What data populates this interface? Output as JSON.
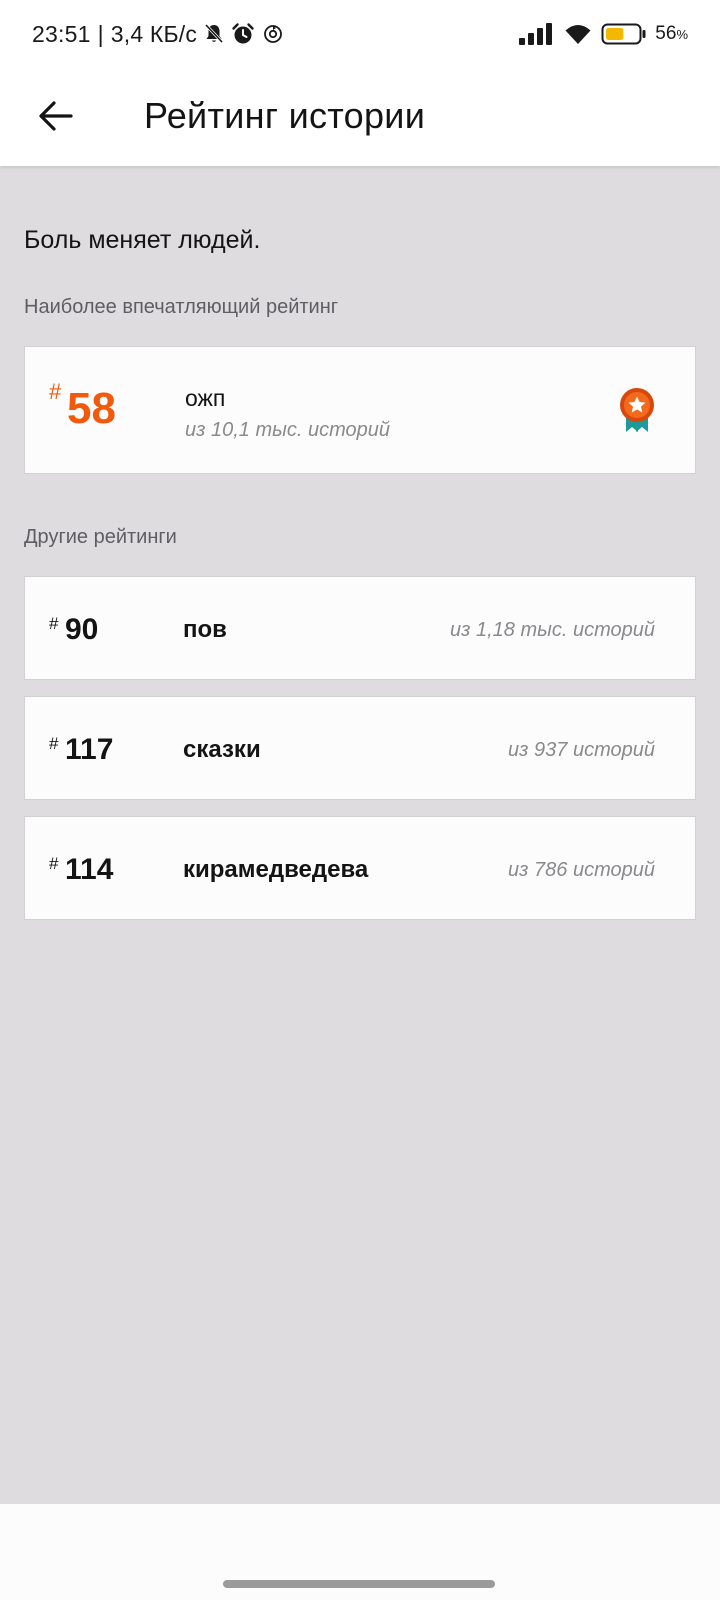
{
  "status_bar": {
    "time": "23:51",
    "separator": "|",
    "network_speed": "3,4 КБ/с",
    "icons_left": [
      "bell-off-icon",
      "alarm-icon",
      "sync-icon"
    ],
    "icons_right": [
      "signal-icon",
      "wifi-icon",
      "battery-icon"
    ],
    "battery_level": 0.56,
    "battery_percent": "56",
    "battery_unit": "%",
    "battery_color": "#f5b800"
  },
  "app_bar": {
    "back_icon": "arrow-left-icon",
    "title": "Рейтинг истории"
  },
  "story": {
    "title": "Боль меняет людей."
  },
  "best_rating": {
    "section_label": "Наиболее впечатляющий рейтинг",
    "hash": "#",
    "rank": "58",
    "tag": "ожп",
    "count_text": "из 10,1 тыс. историй",
    "icon": "award-medal-icon",
    "accent_color": "#f15a0c"
  },
  "other_ratings": {
    "section_label": "Другие рейтинги",
    "items": [
      {
        "hash": "#",
        "rank": "90",
        "tag": "пов",
        "count_text": "из 1,18 тыс. историй"
      },
      {
        "hash": "#",
        "rank": "117",
        "tag": "сказки",
        "count_text": "из 937 историй"
      },
      {
        "hash": "#",
        "rank": "114",
        "tag": "кирамедведева",
        "count_text": "из 786 историй"
      }
    ]
  }
}
